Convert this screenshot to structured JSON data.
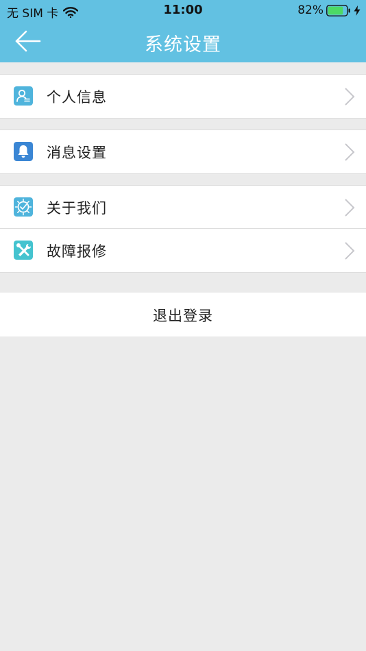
{
  "status_bar": {
    "carrier": "无 SIM 卡",
    "time": "11:00",
    "battery_percent": "82%",
    "battery_level": 0.82,
    "charging": true
  },
  "nav": {
    "title": "系统设置",
    "back_icon": "arrow-left-icon"
  },
  "groups": [
    {
      "items": [
        {
          "label": "个人信息",
          "icon": "person-card-icon"
        }
      ]
    },
    {
      "items": [
        {
          "label": "消息设置",
          "icon": "bell-icon"
        }
      ]
    },
    {
      "items": [
        {
          "label": "关于我们",
          "icon": "about-icon"
        },
        {
          "label": "故障报修",
          "icon": "tools-icon"
        }
      ]
    }
  ],
  "logout": {
    "label": "退出登录"
  },
  "colors": {
    "header": "#62c1e2",
    "icon_light_blue": "#4fb4dc",
    "icon_blue": "#3a86d4",
    "icon_teal": "#44c3cf",
    "background": "#ebebeb",
    "battery_fill": "#4cd964"
  }
}
